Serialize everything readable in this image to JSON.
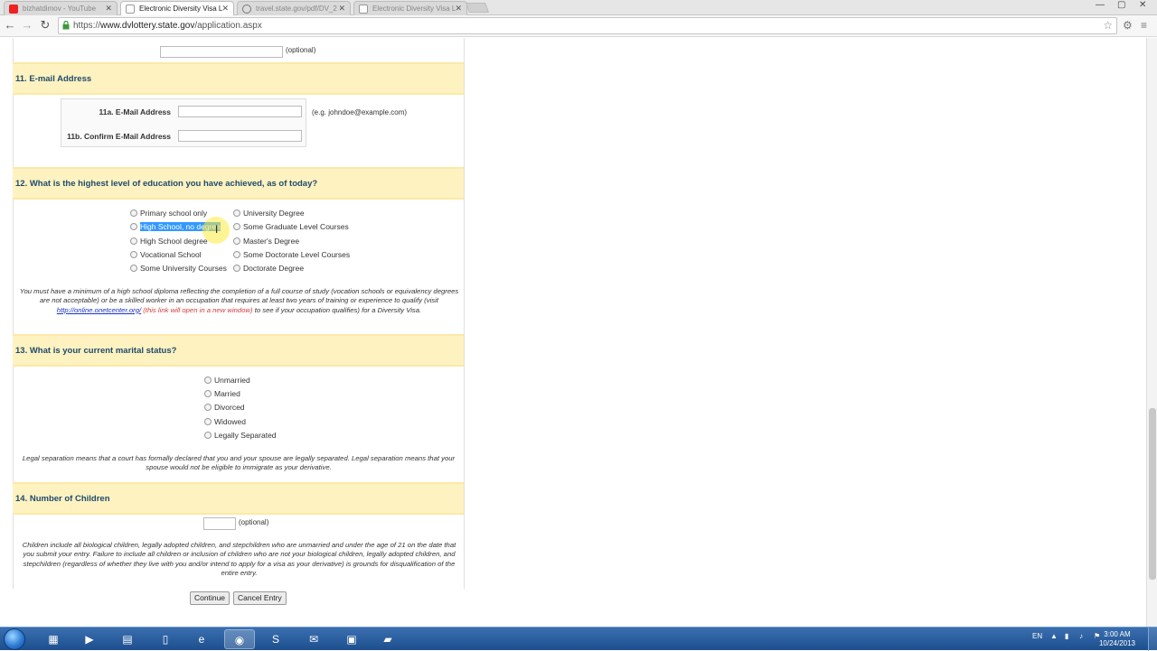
{
  "browser": {
    "tabs": [
      {
        "title": "bizhatdimov - YouTube",
        "active": false
      },
      {
        "title": "Electronic Diversity Visa L",
        "active": true
      },
      {
        "title": "travel.state.gov/pdf/DV_2",
        "active": false
      },
      {
        "title": "Electronic Diversity Visa L",
        "active": false
      }
    ],
    "url_scheme": "https://",
    "url_host": "www.dvlottery.state.gov",
    "url_path": "/application.aspx"
  },
  "form": {
    "optional_label": "(optional)",
    "s11": {
      "title": "11. E-mail Address",
      "email_label": "11a. E-Mail Address",
      "email_value": "",
      "email_hint": "(e.g. johndoe@example.com)",
      "confirm_label": "11b. Confirm E-Mail Address",
      "confirm_value": ""
    },
    "s12": {
      "title": "12. What is the highest level of education you have achieved, as of today?",
      "options_left": [
        "Primary school only",
        "High School, no degree",
        "High School degree",
        "Vocational School",
        "Some University Courses"
      ],
      "options_right": [
        "University Degree",
        "Some Graduate Level Courses",
        "Master's Degree",
        "Some Doctorate Level Courses",
        "Doctorate Degree"
      ],
      "note_pre": "You must have a minimum of a high school diploma reflecting the completion of a full course of study (vocation schools or equivalency degrees are not acceptable) or be a skilled worker in an occupation that requires at least two years of training or experience to qualify (visit ",
      "note_link": "http://online.onetcenter.org/",
      "note_red": " (this link will open in a new window)",
      "note_post": " to see if your occupation qualifies) for a Diversity Visa."
    },
    "s13": {
      "title": "13. What is your current marital status?",
      "options": [
        "Unmarried",
        "Married",
        "Divorced",
        "Widowed",
        "Legally Separated"
      ],
      "note": "Legal separation means that a court has formally declared that you and your spouse are legally separated. Legal separation means that your spouse would not be eligible to immigrate as your derivative."
    },
    "s14": {
      "title": "14. Number of Children",
      "value": "",
      "optional": "(optional)",
      "note": "Children include all biological children, legally adopted children, and stepchildren who are unmarried and under the age of 21 on the date that you submit your entry. Failure to include all children or inclusion of children who are not your biological children, legally adopted children, and stepchildren (regardless of whether they live with you and/or intend to apply for a visa as your derivative) is grounds for disqualification of the entire entry."
    },
    "buttons": {
      "continue": "Continue",
      "cancel": "Cancel Entry"
    }
  },
  "taskbar": {
    "lang": "EN",
    "time": "3:00 AM",
    "date": "10/24/2013"
  },
  "colors": {
    "section_bg": "#fdf2c0",
    "section_text": "#1f4a6b",
    "link": "#1a33c4",
    "link_note": "#d63a3a",
    "selection": "#3399ff"
  }
}
